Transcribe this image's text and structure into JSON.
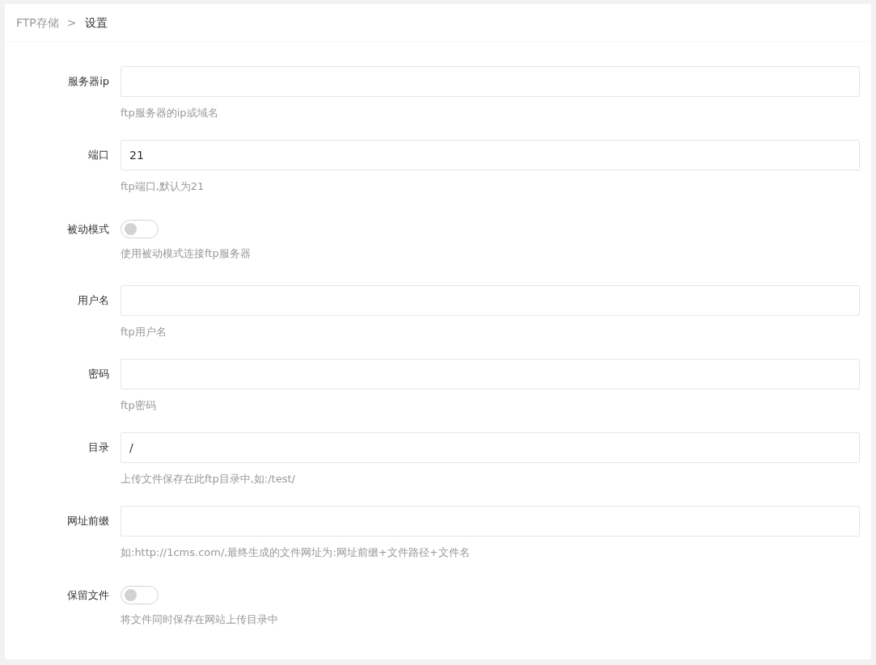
{
  "breadcrumb": {
    "items": [
      {
        "text": "FTP存储",
        "selected": false
      },
      {
        "text": "设置",
        "selected": true
      }
    ],
    "separator": ">"
  },
  "fields": [
    {
      "kind": "text",
      "label": "服务器ip",
      "help": "ftp服务器的ip或域名"
    },
    {
      "kind": "text",
      "label": "端口",
      "value": "21",
      "help": "ftp端口,默认为21"
    },
    {
      "kind": "switch",
      "label": "被动模式",
      "on": false,
      "help": "使用被动模式连接ftp服务器"
    },
    {
      "kind": "text",
      "label": "用户名",
      "help": "ftp用户名"
    },
    {
      "kind": "text",
      "label": "密码",
      "help": "ftp密码"
    },
    {
      "kind": "text",
      "label": "目录",
      "value": "/",
      "help": "上传文件保存在此ftp目录中,如:/test/"
    },
    {
      "kind": "text",
      "label": "网址前缀",
      "help": "如:http://1cms.com/,最终生成的文件网址为:网址前缀+文件路径+文件名"
    },
    {
      "kind": "switch",
      "label": "保留文件",
      "on": false,
      "help": "将文件同时保存在网站上传目录中"
    }
  ]
}
